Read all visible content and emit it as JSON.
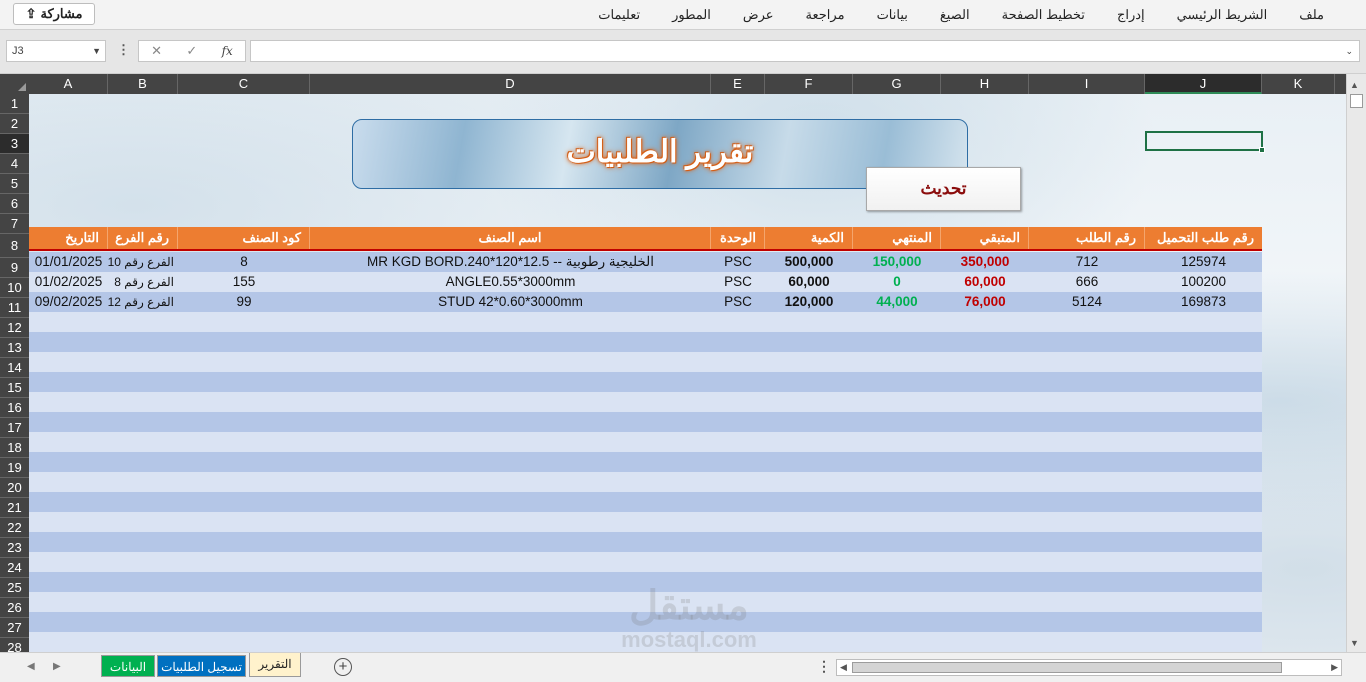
{
  "ribbon": {
    "share_label": "مشاركة",
    "menu": [
      "ملف",
      "الشريط الرئيسي",
      "إدراج",
      "تخطيط الصفحة",
      "الصيغ",
      "بيانات",
      "مراجعة",
      "عرض",
      "المطور",
      "تعليمات"
    ]
  },
  "formula_bar": {
    "name_box": "J3",
    "fx_label": "fx",
    "formula": ""
  },
  "columns": [
    "A",
    "B",
    "C",
    "D",
    "E",
    "F",
    "G",
    "H",
    "I",
    "J",
    "K"
  ],
  "selected_column": "J",
  "rows": [
    "1",
    "2",
    "3",
    "4",
    "5",
    "6",
    "7",
    "8",
    "9",
    "10",
    "11",
    "12",
    "13",
    "14",
    "15",
    "16",
    "17",
    "18",
    "19",
    "20",
    "21",
    "22",
    "23",
    "24",
    "25",
    "26",
    "27",
    "28"
  ],
  "selected_row": "3",
  "sheet": {
    "title": "تقرير الطلبيات",
    "refresh_button": "تحديث"
  },
  "table": {
    "headers": {
      "date": "التاريخ",
      "branch": "رقم الفرع",
      "item_code": "كود الصنف",
      "item_name": "اسم الصنف",
      "unit": "الوحدة",
      "quantity": "الكمية",
      "finished": "المنتهي",
      "remaining": "المتبقي",
      "order_no": "رقم الطلب",
      "load_order_no": "رقم طلب التحميل"
    },
    "rows": [
      {
        "date": "01/01/2025",
        "branch": "الفرع رقم 10",
        "item_code": "8",
        "item_name": "الخليجية رطوبية -- MR KGD BORD.240*120*12.5",
        "unit": "PSC",
        "quantity": "500,000",
        "finished": "150,000",
        "remaining": "350,000",
        "order_no": "712",
        "load_order_no": "125974"
      },
      {
        "date": "01/02/2025",
        "branch": "الفرع رقم 8",
        "item_code": "155",
        "item_name": "ANGLE0.55*3000mm",
        "unit": "PSC",
        "quantity": "60,000",
        "finished": "0",
        "remaining": "60,000",
        "order_no": "666",
        "load_order_no": "100200"
      },
      {
        "date": "09/02/2025",
        "branch": "الفرع رقم 12",
        "item_code": "99",
        "item_name": "STUD 42*0.60*3000mm",
        "unit": "PSC",
        "quantity": "120,000",
        "finished": "44,000",
        "remaining": "76,000",
        "order_no": "5124",
        "load_order_no": "169873"
      }
    ],
    "empty_row_count": 17
  },
  "colors": {
    "header_orange": "#ed7d31",
    "row_odd": "#b4c6e7",
    "row_even": "#dae3f3",
    "finished_green": "#00b050",
    "remaining_red": "#c00000"
  },
  "watermark": {
    "arabic": "مستقل",
    "latin": "mostaql.com"
  },
  "tabs": [
    {
      "label": "البيانات",
      "color": "#00b050",
      "active": false
    },
    {
      "label": "تسجيل الطلبيات",
      "color": "#0070c0",
      "active": false
    },
    {
      "label": "التقرير",
      "color": "#fff2cc",
      "active": true
    }
  ]
}
